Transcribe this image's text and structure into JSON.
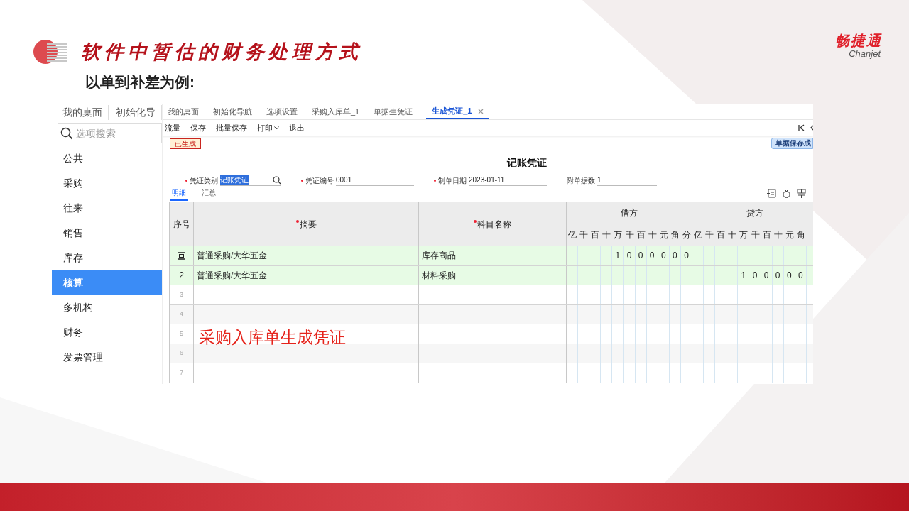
{
  "slide": {
    "title": "软件中暂估的财务处理方式",
    "subtitle": "以单到补差为例:",
    "brand": {
      "name": "畅捷通",
      "latin": "Chanjet"
    },
    "callout": "采购入库单生成凭证"
  },
  "outer_app": {
    "tabs": [
      {
        "label": "我的桌面",
        "selected": false
      },
      {
        "label": "初始化导",
        "selected": false
      }
    ],
    "search": {
      "placeholder": "选项搜索"
    },
    "menu": [
      {
        "label": "公共",
        "selected": false
      },
      {
        "label": "采购",
        "selected": false
      },
      {
        "label": "往来",
        "selected": false
      },
      {
        "label": "销售",
        "selected": false
      },
      {
        "label": "库存",
        "selected": false
      },
      {
        "label": "核算",
        "selected": true
      },
      {
        "label": "多机构",
        "selected": false
      },
      {
        "label": "财务",
        "selected": false
      },
      {
        "label": "发票管理",
        "selected": false
      }
    ]
  },
  "window": {
    "tabs": [
      {
        "label": "我的桌面",
        "selected": false,
        "closable": false
      },
      {
        "label": "初始化导航",
        "selected": false,
        "closable": false
      },
      {
        "label": "选项设置",
        "selected": false,
        "closable": false
      },
      {
        "label": "采购入库单_1",
        "selected": false,
        "closable": false
      },
      {
        "label": "单据生凭证",
        "selected": false,
        "closable": false
      },
      {
        "label": "生成凭证_1",
        "selected": true,
        "closable": true
      }
    ],
    "toolbar": [
      {
        "label": "流量",
        "dropdown": false
      },
      {
        "label": "保存",
        "dropdown": false
      },
      {
        "label": "批量保存",
        "dropdown": false
      },
      {
        "label": "打印",
        "dropdown": true
      },
      {
        "label": "退出",
        "dropdown": false
      }
    ],
    "status_badge": "已生成",
    "notice": "单据保存成",
    "voucher_title": "记账凭证",
    "fields": [
      {
        "label": "凭证类别",
        "value": "记账凭证",
        "required": true,
        "selected": true,
        "search": true
      },
      {
        "label": "凭证编号",
        "value": "0001",
        "required": true,
        "selected": false,
        "search": false
      },
      {
        "label": "制单日期",
        "value": "2023-01-11",
        "required": true,
        "selected": false,
        "search": false
      },
      {
        "label": "附单据数",
        "value": "1",
        "required": false,
        "selected": false,
        "search": false
      }
    ],
    "subtabs": [
      {
        "label": "明细",
        "selected": true
      },
      {
        "label": "汇总",
        "selected": false
      }
    ],
    "table": {
      "columns": [
        {
          "label": "序号",
          "required": false
        },
        {
          "label": "摘要",
          "required": true
        },
        {
          "label": "科目名称",
          "required": true
        }
      ],
      "debit": {
        "label": "借方",
        "digits": [
          "亿",
          "千",
          "百",
          "十",
          "万",
          "千",
          "百",
          "十",
          "元",
          "角",
          "分"
        ]
      },
      "credit": {
        "label": "贷方",
        "digits": [
          "亿",
          "千",
          "百",
          "十",
          "万",
          "千",
          "百",
          "十",
          "元",
          "角"
        ]
      },
      "rows": [
        {
          "kind": "current",
          "summary": "普通采购/大华五金",
          "account": "库存商品",
          "debit": "1 0 0 0 0 0 0"
        },
        {
          "kind": "entry",
          "seq": "2",
          "summary": "普通采购/大华五金",
          "account": "材料采购",
          "credit": "1 0 0 0 0 0"
        },
        {
          "kind": "blank",
          "seq": "3"
        },
        {
          "kind": "blank",
          "seq": "4"
        },
        {
          "kind": "blank",
          "seq": "5"
        },
        {
          "kind": "blank",
          "seq": "6"
        },
        {
          "kind": "blank",
          "seq": "7"
        }
      ]
    }
  }
}
